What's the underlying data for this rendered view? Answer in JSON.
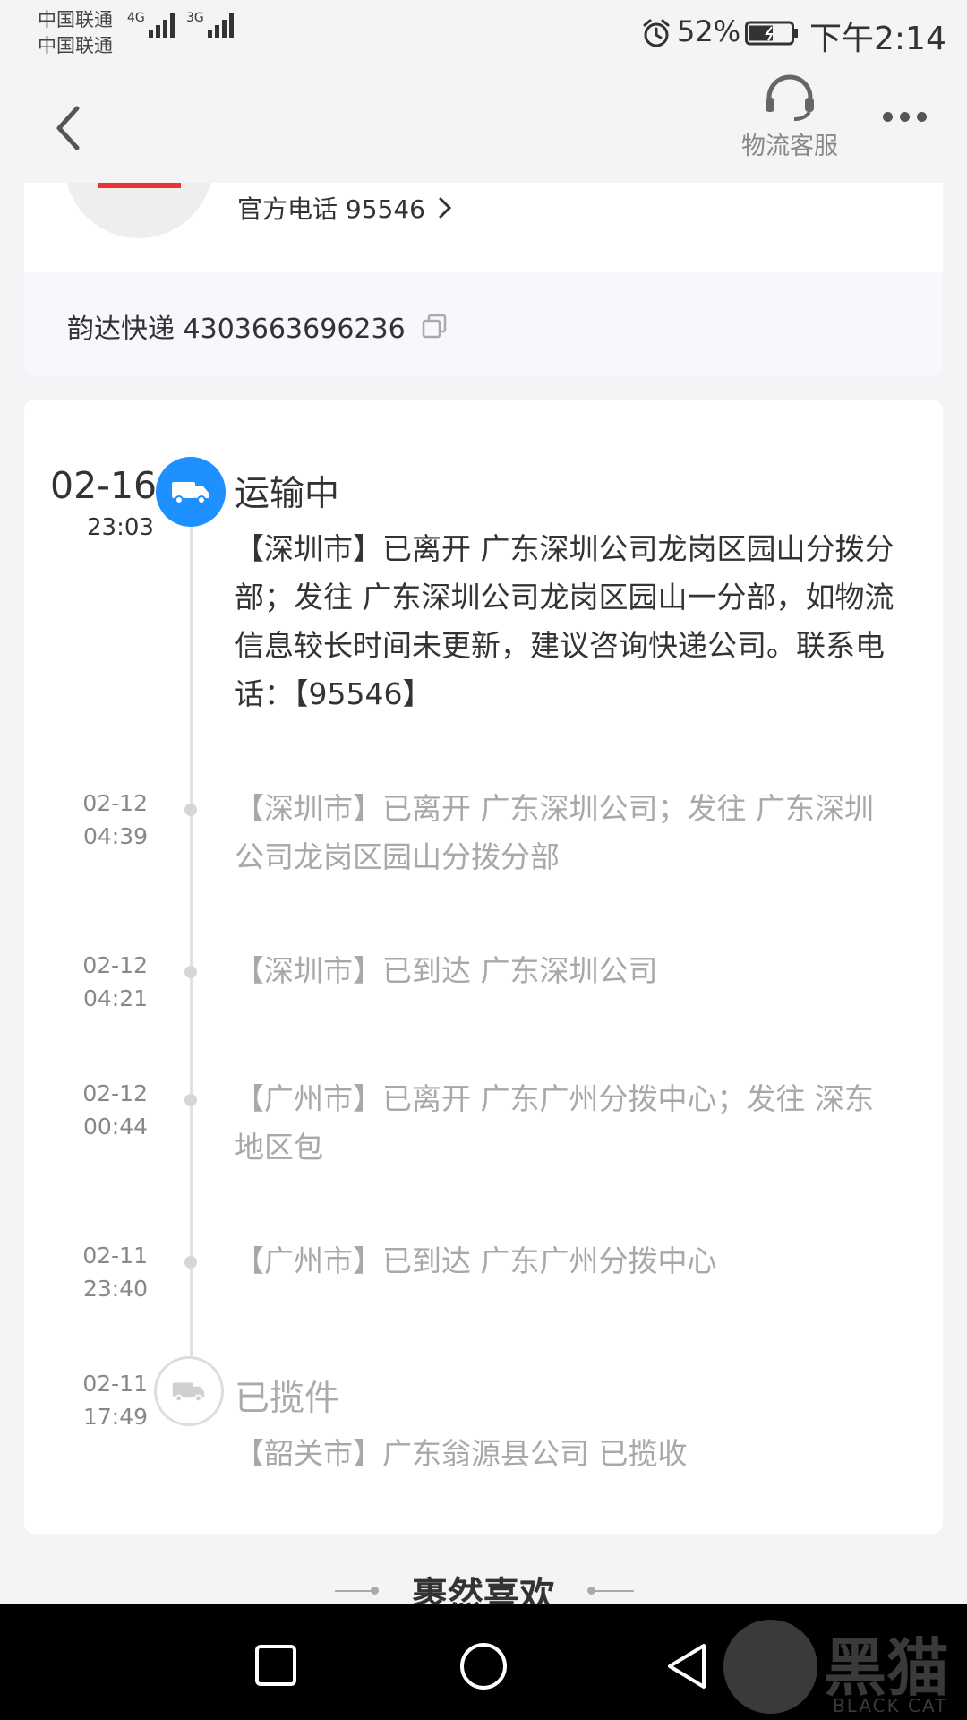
{
  "status_bar": {
    "carrier1": "中国联通",
    "carrier2": "中国联通",
    "net1": "4G",
    "net2": "3G",
    "battery": "52%",
    "time": "下午2:14"
  },
  "header": {
    "back_icon": "chevron-left-icon",
    "service_icon": "headset-icon",
    "service_label": "物流客服",
    "more_icon": "more-dots-icon"
  },
  "courier": {
    "phone_label": "官方电话 95546",
    "tracking_label": "韵达快递 4303663696236",
    "copy_icon": "copy-icon"
  },
  "timeline": {
    "current": {
      "date": "02-16",
      "time": "23:03",
      "status": "运输中",
      "detail": "【深圳市】已离开 广东深圳公司龙岗区园山分拨分部；发往 广东深圳公司龙岗区园山一分部，如物流信息较长时间未更新，建议咨询快递公司。联系电话：【95546】"
    },
    "events": [
      {
        "date": "02-12",
        "time": "04:39",
        "text": "【深圳市】已离开 广东深圳公司；发往 广东深圳公司龙岗区园山分拨分部"
      },
      {
        "date": "02-12",
        "time": "04:21",
        "text": "【深圳市】已到达 广东深圳公司"
      },
      {
        "date": "02-12",
        "time": "00:44",
        "text": "【广州市】已离开 广东广州分拨中心；发往 深东地区包"
      },
      {
        "date": "02-11",
        "time": "23:40",
        "text": "【广州市】已到达 广东广州分拨中心"
      }
    ],
    "pickup": {
      "date": "02-11",
      "time": "17:49",
      "status": "已揽件",
      "detail": "【韶关市】广东翁源县公司 已揽收"
    }
  },
  "section_title": "裹然喜欢",
  "watermark": {
    "text": "黑猫",
    "sub": "BLACK CAT"
  },
  "nav": {
    "recent_icon": "square-recent-icon",
    "home_icon": "circle-home-icon",
    "back_icon": "triangle-back-icon"
  }
}
